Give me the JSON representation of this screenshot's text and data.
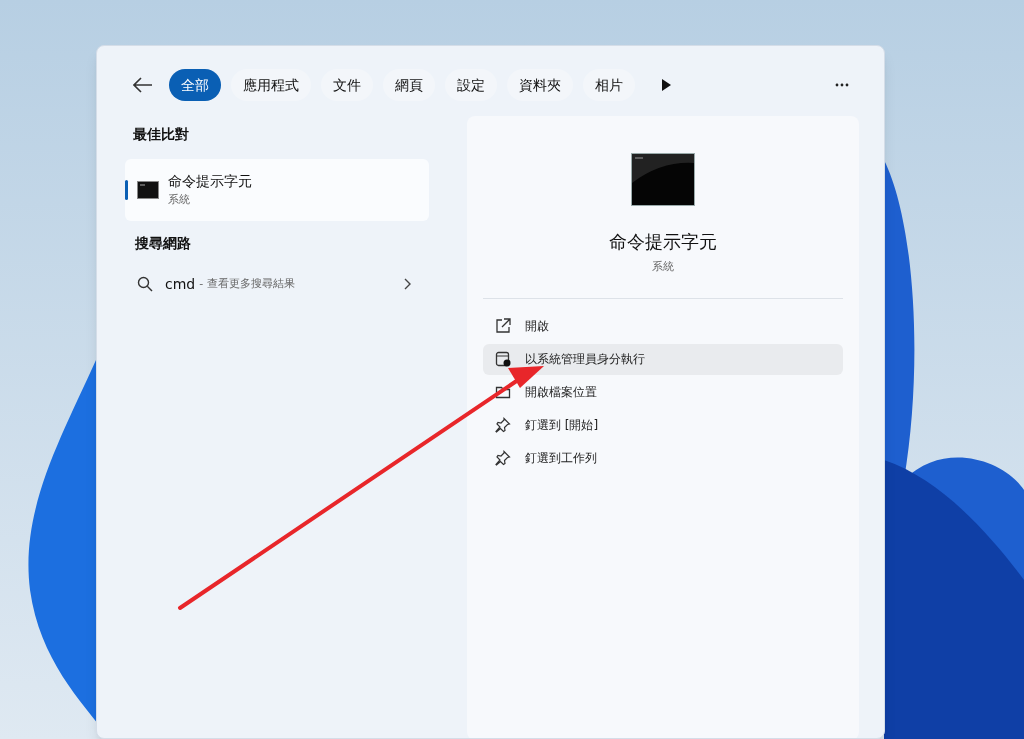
{
  "filters": [
    {
      "label": "全部",
      "selected": true
    },
    {
      "label": "應用程式",
      "selected": false
    },
    {
      "label": "文件",
      "selected": false
    },
    {
      "label": "網頁",
      "selected": false
    },
    {
      "label": "設定",
      "selected": false
    },
    {
      "label": "資料夾",
      "selected": false
    },
    {
      "label": "相片",
      "selected": false
    }
  ],
  "best_match": {
    "heading": "最佳比對",
    "item": {
      "title": "命令提示字元",
      "subtitle": "系統",
      "selected": true
    }
  },
  "web_search": {
    "heading": "搜尋網路",
    "query": "cmd",
    "hint": "- 查看更多搜尋結果"
  },
  "detail": {
    "title": "命令提示字元",
    "subtitle": "系統",
    "actions": [
      {
        "kind": "open",
        "label": "開啟",
        "highlighted": false
      },
      {
        "kind": "admin",
        "label": "以系統管理員身分執行",
        "highlighted": true
      },
      {
        "kind": "folder",
        "label": "開啟檔案位置",
        "highlighted": false
      },
      {
        "kind": "pin",
        "label": "釘選到 [開始]",
        "highlighted": false
      },
      {
        "kind": "pin",
        "label": "釘選到工作列",
        "highlighted": false
      }
    ]
  }
}
